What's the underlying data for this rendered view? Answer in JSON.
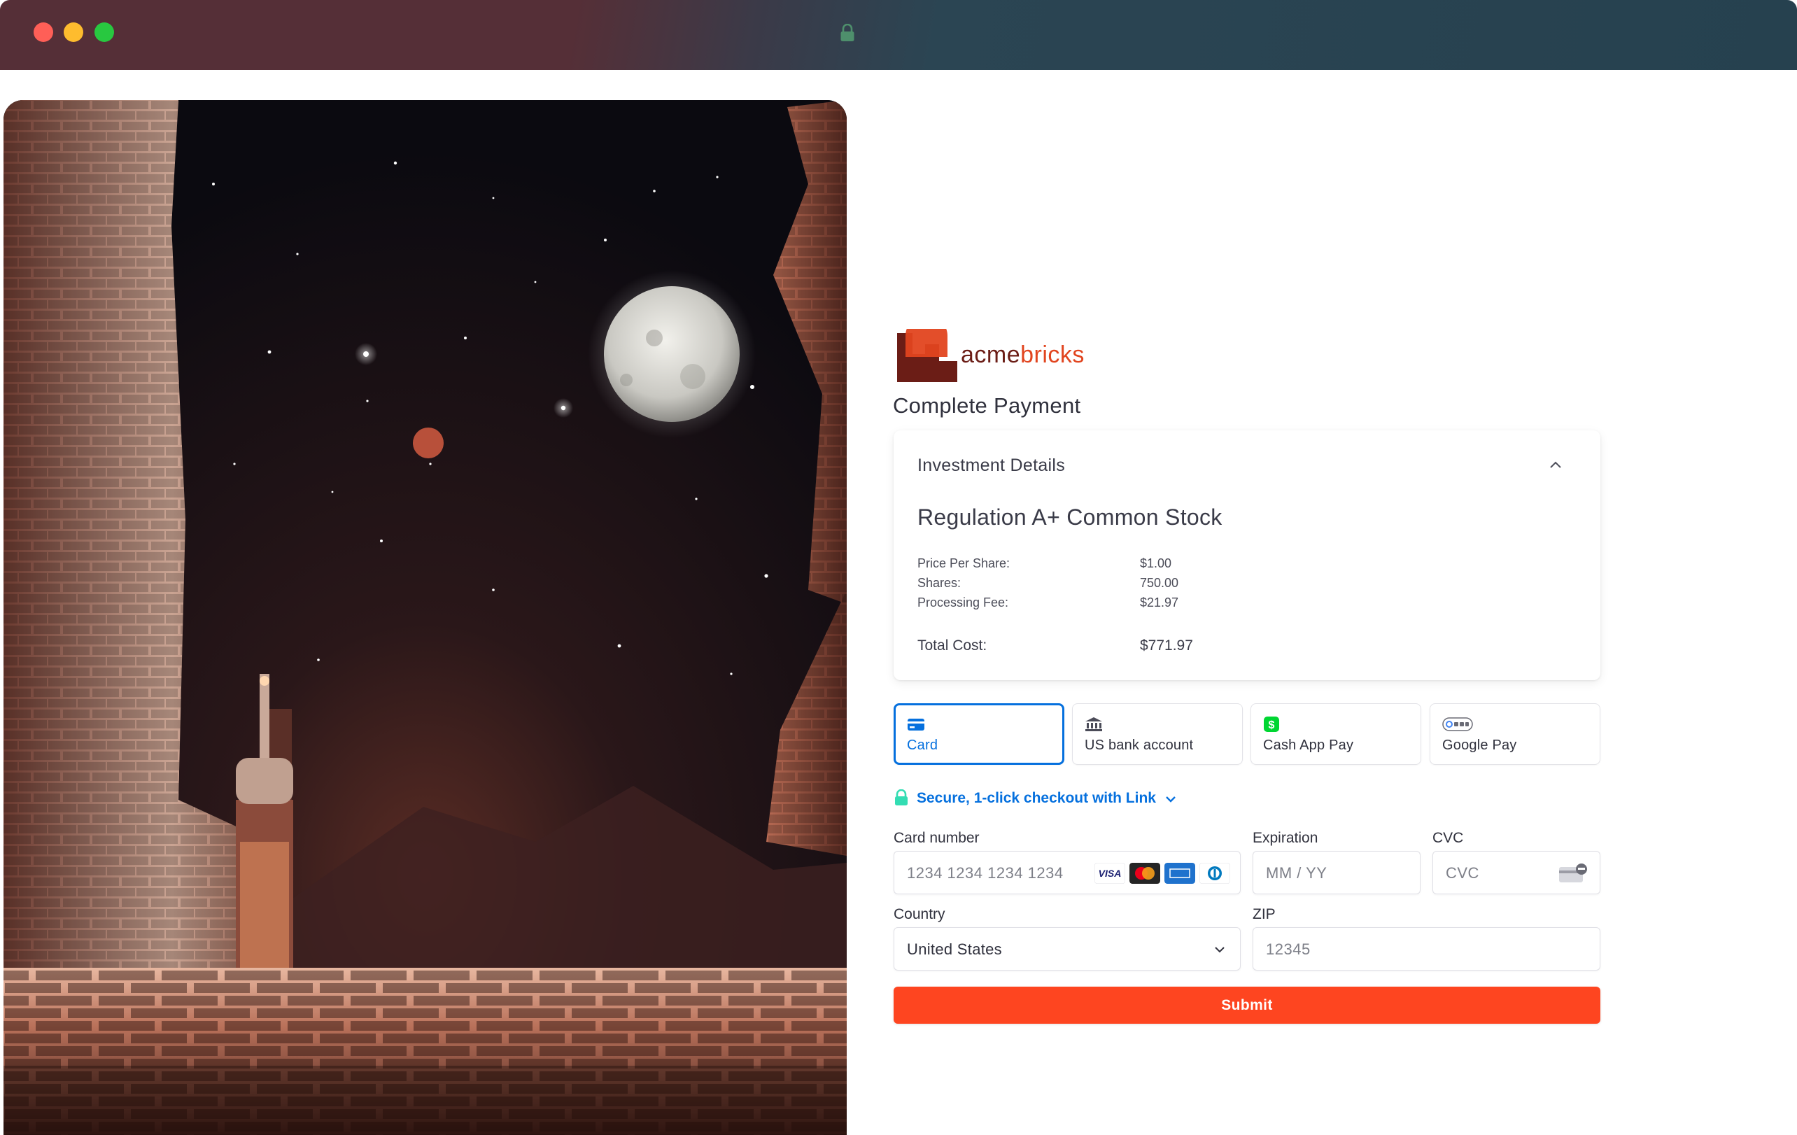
{
  "window": {
    "controls": [
      "close",
      "minimize",
      "zoom"
    ],
    "address_icon": "lock-icon"
  },
  "hero": {
    "description_icon": "space-bricks-illustration"
  },
  "brand": {
    "name_part1": "acme",
    "name_part2": "bricks",
    "accent": "#e1451f",
    "dark": "#6b1d16"
  },
  "page": {
    "title": "Complete Payment"
  },
  "investment": {
    "heading": "Investment Details",
    "product": "Regulation A+ Common Stock",
    "rows": [
      {
        "label": "Price Per Share:",
        "value": "$1.00"
      },
      {
        "label": "Shares:",
        "value": "750.00"
      },
      {
        "label": "Processing Fee:",
        "value": "$21.97"
      }
    ],
    "total_label": "Total Cost:",
    "total_value": "$771.97"
  },
  "payment_tabs": [
    {
      "label": "Card",
      "icon": "card-icon",
      "active": true
    },
    {
      "label": "US bank account",
      "icon": "bank-icon",
      "active": false
    },
    {
      "label": "Cash App Pay",
      "icon": "cash-app-icon",
      "active": false
    },
    {
      "label": "Google Pay",
      "icon": "google-pay-icon",
      "active": false
    }
  ],
  "link": {
    "text": "Secure, 1-click checkout with Link"
  },
  "form": {
    "card_number_label": "Card number",
    "card_number_placeholder": "1234 1234 1234 1234",
    "expiration_label": "Expiration",
    "expiration_placeholder": "MM / YY",
    "cvc_label": "CVC",
    "cvc_placeholder": "CVC",
    "country_label": "Country",
    "country_value": "United States",
    "zip_label": "ZIP",
    "zip_placeholder": "12345",
    "card_brands": [
      "visa-icon",
      "mastercard-icon",
      "amex-icon",
      "diners-icon"
    ]
  },
  "submit": {
    "label": "Submit",
    "color": "#fe4520"
  },
  "colors": {
    "primary": "#0570de",
    "text": "#30313d"
  }
}
